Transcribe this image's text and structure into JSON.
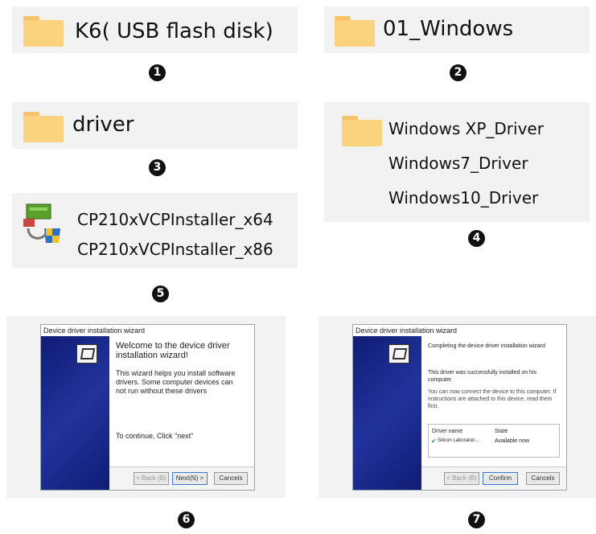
{
  "steps": [
    "1",
    "2",
    "3",
    "4",
    "5",
    "6",
    "7"
  ],
  "panel1": {
    "label": "K6( USB flash disk)",
    "icon": "folder-icon"
  },
  "panel2": {
    "label": "01_Windows",
    "icon": "folder-icon"
  },
  "panel3": {
    "label": "driver",
    "icon": "folder-icon"
  },
  "panel4": {
    "items": [
      "Windows XP_Driver",
      "Windows7_Driver",
      "Windows10_Driver"
    ],
    "icon": "folder-icon"
  },
  "panel5": {
    "items": [
      "CP210xVCPInstaller_x64",
      "CP210xVCPInstaller_x86"
    ],
    "icon": "installer-icon"
  },
  "wizard1": {
    "title": "Device driver installation wizard",
    "heading": "Welcome to the device driver installation wizard!",
    "body": "This wizard helps you install software drivers. Some computer devices can not run without these drivers",
    "continue": "To continue, Click \"next\"",
    "back": "< Back (B)",
    "next": "Next(N) >",
    "cancel": "Cancels"
  },
  "wizard2": {
    "title": "Device driver installation wizard",
    "heading": "Completing the device driver installation wizard",
    "body": "This driver was successfully installed on his computer.",
    "body2": "You can now connect the device to this computer. If instructions are attached to this device, read them first.",
    "col_name": "Driver name",
    "col_state": "State",
    "row_name": "Silicon Laboratori...",
    "row_state": "Available now",
    "back": "< Back (B)",
    "confirm": "Confirm",
    "cancel": "Cancels"
  },
  "colors": {
    "folder": "#fbd27d",
    "panel": "#f2f2f2",
    "wizard_side": "#1a2a8c"
  }
}
